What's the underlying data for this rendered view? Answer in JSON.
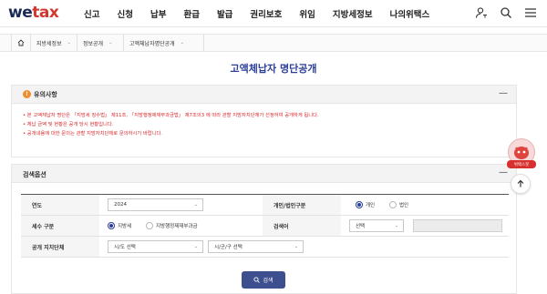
{
  "header": {
    "logo_main": "we",
    "logo_accent": "tax",
    "nav": [
      "신고",
      "신청",
      "납부",
      "환급",
      "발급",
      "권리보호",
      "위임",
      "지방세정보",
      "나의위택스"
    ],
    "icons": [
      "user-icon",
      "search-icon",
      "menu-icon"
    ]
  },
  "breadcrumb": {
    "home_icon": "home-icon",
    "items": [
      "지방세정보",
      "정보공개",
      "고액체납자명단공개"
    ]
  },
  "page_title": "고액체납자 명단공개",
  "notice": {
    "title": "유의사항",
    "lines": [
      "• 본 고액체납자 명단은 「지방세 징수법」 제11조, 「지방행정제재부과금법」 제7조의3 에 따라 관할 지방자치단체가 선정하여 공개하게 됩니다.",
      "• 체납 금액 및 현황은 공개 당시 현황입니다.",
      "• 공개내용에 대한 문의는 관할 지방자치단체로 문의하시기 바랍니다."
    ]
  },
  "search": {
    "title": "검색옵션",
    "year_label": "연도",
    "year_value": "2024",
    "type_label": "개인/법인구분",
    "type_options": [
      "개인",
      "법인"
    ],
    "type_selected": "개인",
    "tax_label": "세수 구분",
    "tax_options": [
      "지방세",
      "지방행정제재부과금"
    ],
    "tax_selected": "지방세",
    "keyword_label": "검색어",
    "keyword_select": "선택",
    "keyword_value": "",
    "region_label": "공개 지치단체",
    "region_sido": "시/도 선택",
    "region_sigungu": "시/군/구 선택",
    "search_button": "검색"
  },
  "floating": {
    "mascot_label": "위택스봇",
    "top_icon": "arrow-up-icon"
  },
  "colors": {
    "brand": "#1a2a56",
    "accent": "#d2362f",
    "title": "#2b3f97",
    "notice_text": "#d8262b",
    "button": "#3d4f8e"
  }
}
